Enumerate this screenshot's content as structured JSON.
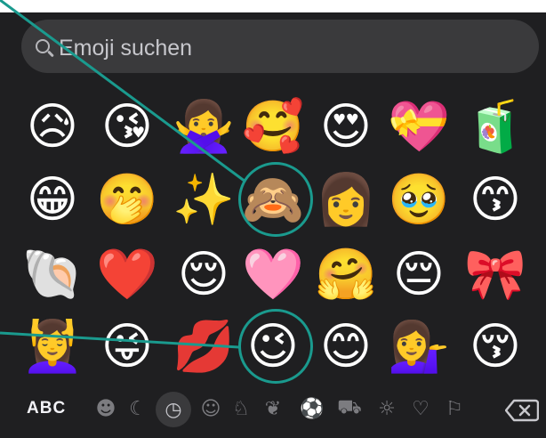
{
  "search": {
    "placeholder": "Emoji suchen"
  },
  "emoji_rows": [
    [
      "😥",
      "😘",
      "🙅‍♀️",
      "🥰",
      "😍",
      "💝",
      "🧃"
    ],
    [
      "😁",
      "🤭",
      "✨",
      "🙈",
      "👩",
      "🥹",
      "😙"
    ],
    [
      "🐚",
      "❤️",
      "😌",
      "🩷",
      "🤗",
      "😔",
      "🎀"
    ],
    [
      "💆‍♀️",
      "😜",
      "💋",
      "😉",
      "😊",
      "💁‍♀️",
      "😚"
    ]
  ],
  "highlighted": [
    "🙈",
    "😉"
  ],
  "toolbar": {
    "abc_label": "ABC",
    "categories": [
      {
        "icon": "face-sunglasses-icon",
        "glyph": "☻"
      },
      {
        "icon": "moon-icon",
        "glyph": "☾"
      },
      {
        "icon": "clock-icon",
        "glyph": "◷",
        "active": true
      },
      {
        "icon": "smiley-icon",
        "glyph": "☺"
      },
      {
        "icon": "dog-icon",
        "glyph": "♘"
      },
      {
        "icon": "apple-icon",
        "glyph": "❦"
      },
      {
        "icon": "soccer-icon",
        "glyph": "⚽"
      },
      {
        "icon": "car-icon",
        "glyph": "⛟"
      },
      {
        "icon": "lightbulb-icon",
        "glyph": "☼"
      },
      {
        "icon": "heart-icon",
        "glyph": "♡"
      },
      {
        "icon": "flag-icon",
        "glyph": "⚐"
      }
    ]
  },
  "colors": {
    "background": "#1f1f21",
    "search_bg": "#3a3a3c",
    "highlight": "#1a9a8e"
  }
}
